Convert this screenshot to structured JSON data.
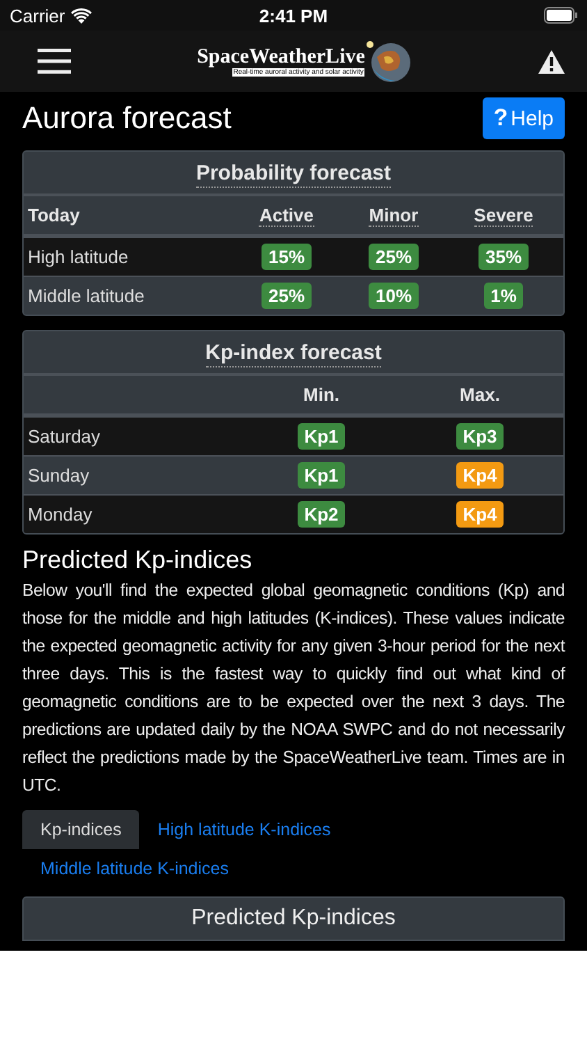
{
  "status_bar": {
    "carrier": "Carrier",
    "time": "2:41 PM"
  },
  "nav": {
    "logo_title": "SpaceWeatherLive",
    "logo_tagline": "Real-time auroral activity and solar activity"
  },
  "page": {
    "title": "Aurora forecast",
    "help_button": "Help",
    "help_icon": "?"
  },
  "probability_forecast": {
    "title": "Probability forecast",
    "corner": "Today",
    "columns": [
      "Active",
      "Minor",
      "Severe"
    ],
    "rows": [
      {
        "label": "High latitude",
        "cells": [
          {
            "text": "15%",
            "color": "#3d8b40"
          },
          {
            "text": "25%",
            "color": "#3d8b40"
          },
          {
            "text": "35%",
            "color": "#3d8b40"
          }
        ]
      },
      {
        "label": "Middle latitude",
        "cells": [
          {
            "text": "25%",
            "color": "#3d8b40"
          },
          {
            "text": "10%",
            "color": "#3d8b40"
          },
          {
            "text": "1%",
            "color": "#3d8b40"
          }
        ]
      }
    ]
  },
  "kp_forecast": {
    "title": "Kp-index forecast",
    "columns": [
      "Min.",
      "Max."
    ],
    "rows": [
      {
        "label": "Saturday",
        "cells": [
          {
            "text": "Kp1",
            "color": "#3d8b40"
          },
          {
            "text": "Kp3",
            "color": "#3d8b40"
          }
        ]
      },
      {
        "label": "Sunday",
        "cells": [
          {
            "text": "Kp1",
            "color": "#3d8b40"
          },
          {
            "text": "Kp4",
            "color": "#f39a12"
          }
        ]
      },
      {
        "label": "Monday",
        "cells": [
          {
            "text": "Kp2",
            "color": "#3d8b40"
          },
          {
            "text": "Kp4",
            "color": "#f39a12"
          }
        ]
      }
    ]
  },
  "predicted": {
    "heading": "Predicted Kp-indices",
    "paragraph": "Below you'll find the expected global geomagnetic conditions (Kp) and those for the middle and high latitudes (K-indices). These values indicate the expected geomagnetic activity for any given 3-hour period for the next three days. This is the fastest way to quickly find out what kind of geomagnetic conditions are to be expected over the next 3 days. The predictions are updated daily by the NOAA SWPC and do not necessarily reflect the predictions made by the SpaceWeatherLive team. Times are in UTC.",
    "tabs": [
      {
        "label": "Kp-indices",
        "selected": true
      },
      {
        "label": "High latitude K-indices",
        "selected": false
      },
      {
        "label": "Middle latitude K-indices",
        "selected": false
      }
    ],
    "card_title": "Predicted Kp-indices"
  }
}
